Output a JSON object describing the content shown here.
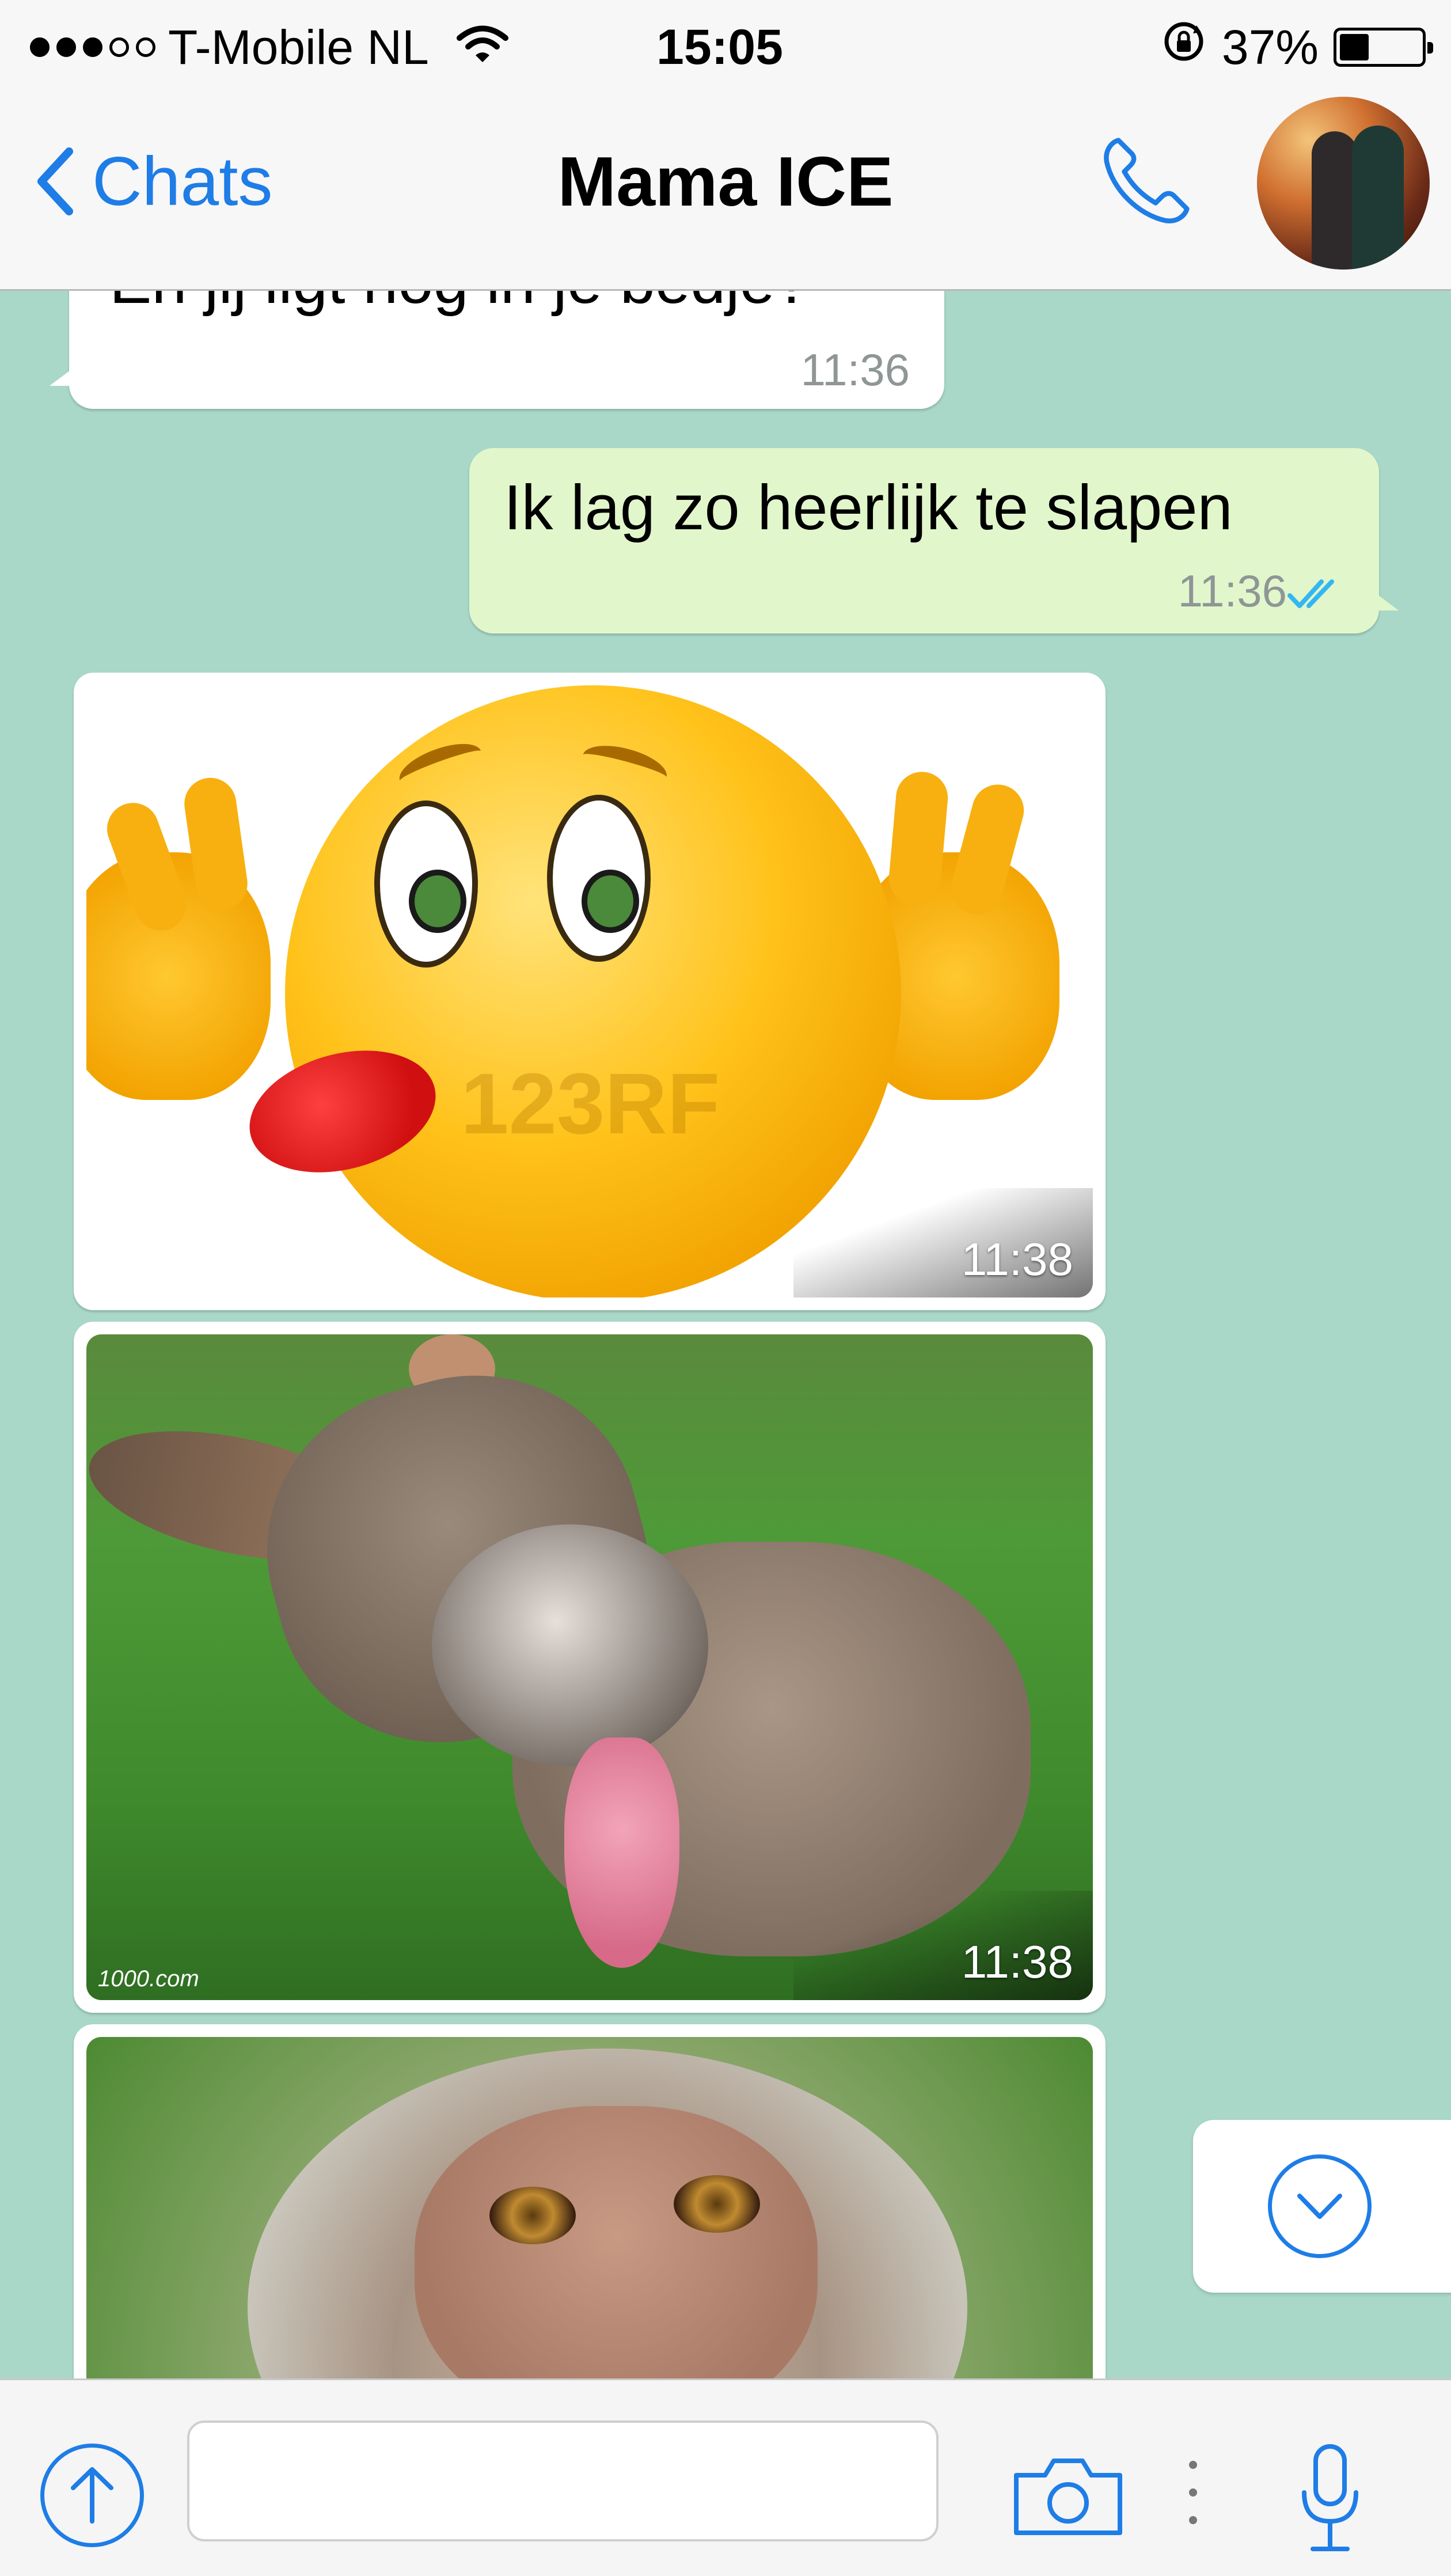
{
  "status_bar": {
    "carrier": "T-Mobile NL",
    "time": "15:05",
    "battery_percent_label": "37%",
    "battery_level": 0.37,
    "signal_bars_filled": 3,
    "signal_bars_total": 5
  },
  "nav": {
    "back_label": "Chats",
    "title": "Mama ICE",
    "call_icon": "phone-icon",
    "avatar_icon": "contact-avatar"
  },
  "messages": [
    {
      "direction": "incoming",
      "type": "text",
      "text": "En jij ligt nog in je bedje?",
      "time": "11:36"
    },
    {
      "direction": "outgoing",
      "type": "text",
      "text": "Ik lag zo heerlijk te slapen",
      "time": "11:36",
      "status_icon": "double-check-icon"
    },
    {
      "direction": "incoming",
      "type": "image",
      "subject": "emoji",
      "time": "11:38",
      "watermark": "123RF"
    },
    {
      "direction": "incoming",
      "type": "image",
      "subject": "donkey",
      "time": "11:38",
      "credit": "1000.com"
    },
    {
      "direction": "incoming",
      "type": "image",
      "subject": "monkey",
      "time": ""
    }
  ],
  "scroll_down_icon": "chevron-down-circle-icon",
  "input_bar": {
    "attach_icon": "arrow-up-circle-icon",
    "text_value": "",
    "camera_icon": "camera-icon",
    "mic_icon": "microphone-icon"
  },
  "colors": {
    "accent": "#1e7de6",
    "chat_background": "#a9d8c8",
    "outgoing_bubble": "#e1f7cb",
    "incoming_bubble": "#ffffff",
    "read_check": "#34b7f1"
  }
}
